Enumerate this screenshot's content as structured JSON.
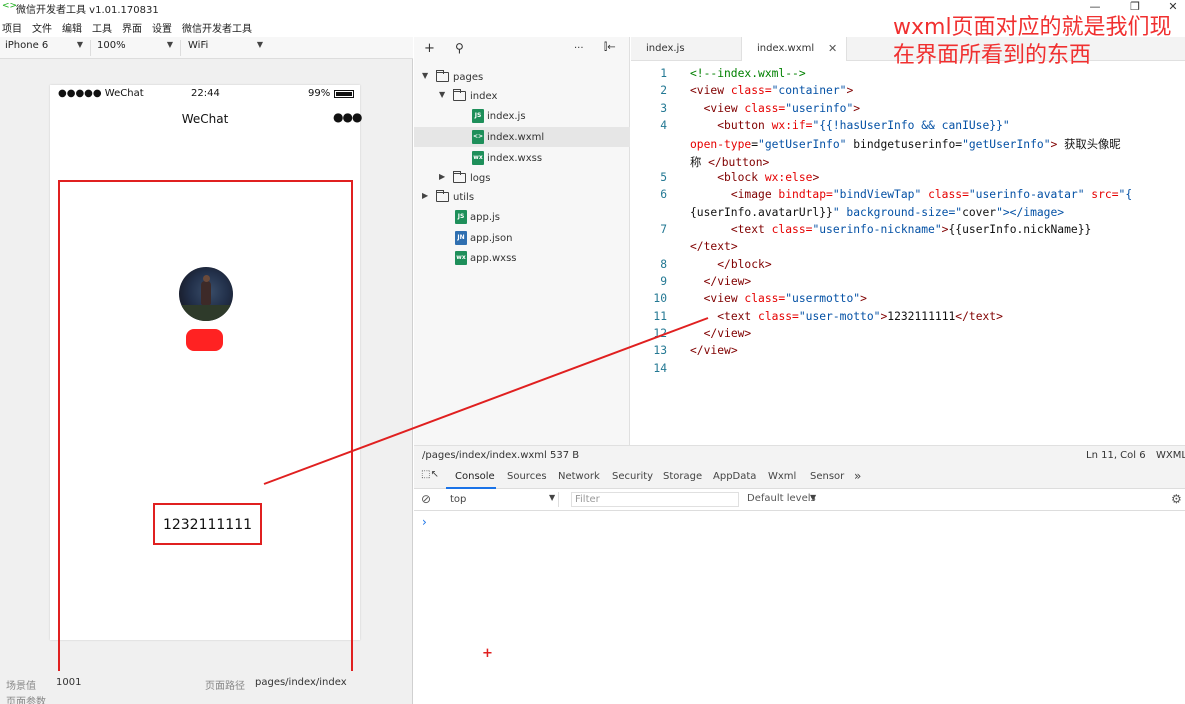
{
  "window": {
    "logo_glyph": "<>",
    "title": "微信开发者工具 v1.01.170831",
    "minimize_glyph": "—",
    "restore_glyph": "❐",
    "close_glyph": "✕"
  },
  "menu": {
    "items": [
      "项目",
      "文件",
      "编辑",
      "工具",
      "界面",
      "设置",
      "微信开发者工具"
    ]
  },
  "device_toolbar": {
    "device": "iPhone 6",
    "zoom": "100%",
    "network": "WiFi"
  },
  "simulator": {
    "status": {
      "signal": "●●●●● WeChat",
      "time": "22:44",
      "battery": "99%",
      "battery_level": 0.99
    },
    "nav_title": "WeChat",
    "nav_menu_glyph": "●●●",
    "motto": "1232111111"
  },
  "footer": {
    "scene_label": "场景值",
    "scene_value": "1001",
    "path_label": "页面路径",
    "path_value": "pages/index/index",
    "params_label": "页面参数"
  },
  "file_tree": {
    "toolbar": {
      "add": "+",
      "search": "⚲",
      "more": "···",
      "collapse": "⫿←"
    },
    "items": [
      {
        "label": "pages",
        "type": "folder",
        "depth": 0,
        "expanded": true
      },
      {
        "label": "index",
        "type": "folder",
        "depth": 1,
        "expanded": true
      },
      {
        "label": "index.js",
        "type": "js",
        "badge": "JS",
        "depth": 2
      },
      {
        "label": "index.wxml",
        "type": "wxml",
        "badge": "<>",
        "depth": 2,
        "selected": true
      },
      {
        "label": "index.wxss",
        "type": "wxss",
        "badge": "wx",
        "depth": 2
      },
      {
        "label": "logs",
        "type": "folder",
        "depth": 1,
        "expanded": false
      },
      {
        "label": "utils",
        "type": "folder",
        "depth": 0,
        "expanded": false
      },
      {
        "label": "app.js",
        "type": "js",
        "badge": "JS",
        "depth": 1
      },
      {
        "label": "app.json",
        "type": "json",
        "badge": "JN",
        "depth": 1
      },
      {
        "label": "app.wxss",
        "type": "wxss",
        "badge": "wx",
        "depth": 1
      }
    ]
  },
  "editor": {
    "tabs": [
      {
        "label": "index.js",
        "active": false
      },
      {
        "label": "index.wxml",
        "active": true,
        "close_glyph": "✕"
      }
    ],
    "line_numbers": [
      "1",
      "2",
      "3",
      "4",
      "5",
      "6",
      "7",
      "8",
      "9",
      "10",
      "11",
      "12",
      "13",
      "14"
    ],
    "code_lines": [
      "<!--index.wxml-->",
      "<view class=\"container\">",
      "  <view class=\"userinfo\">",
      "    <button wx:if=\"{{!hasUserInfo && canIUse}}\"",
      "open-type=\"getUserInfo\" bindgetuserinfo=\"getUserInfo\"> 获取头像昵",
      "称 </button>",
      "    <block wx:else>",
      "      <image bindtap=\"bindViewTap\" class=\"userinfo-avatar\" src=\"{",
      "{userInfo.avatarUrl}}\" background-size=\"cover\"></image>",
      "      <text class=\"userinfo-nickname\">{{userInfo.nickName}}",
      "</text>",
      "    </block>",
      "  </view>",
      "  <view class=\"usermotto\">",
      "    <text class=\"user-motto\">1232111111</text>",
      "  </view>",
      "</view>"
    ]
  },
  "annotation": "wxml页面对应的就是我们现在界面所看到的东西",
  "editor_status": {
    "path": "/pages/index/index.wxml",
    "size": "537 B",
    "cursor": "Ln 11, Col 6",
    "language": "WXML"
  },
  "devtools": {
    "inspect_glyph": "⬚↖",
    "tabs": [
      "Console",
      "Sources",
      "Network",
      "Security",
      "Storage",
      "AppData",
      "Wxml",
      "Sensor"
    ],
    "more_glyph": "»",
    "active_tab": "Console",
    "context": "top",
    "filter_placeholder": "Filter",
    "levels": "Default levels",
    "levels_caret": "▼",
    "settings_glyph": "⚙",
    "clear_glyph": "⊘",
    "prompt_glyph": "›",
    "cursor_glyph": "+"
  },
  "colors": {
    "highlight_red": "#e02020",
    "wxml_badge": "#1e8f5a",
    "js_badge": "#1e8f5a",
    "json_badge": "#2f6fb0"
  }
}
